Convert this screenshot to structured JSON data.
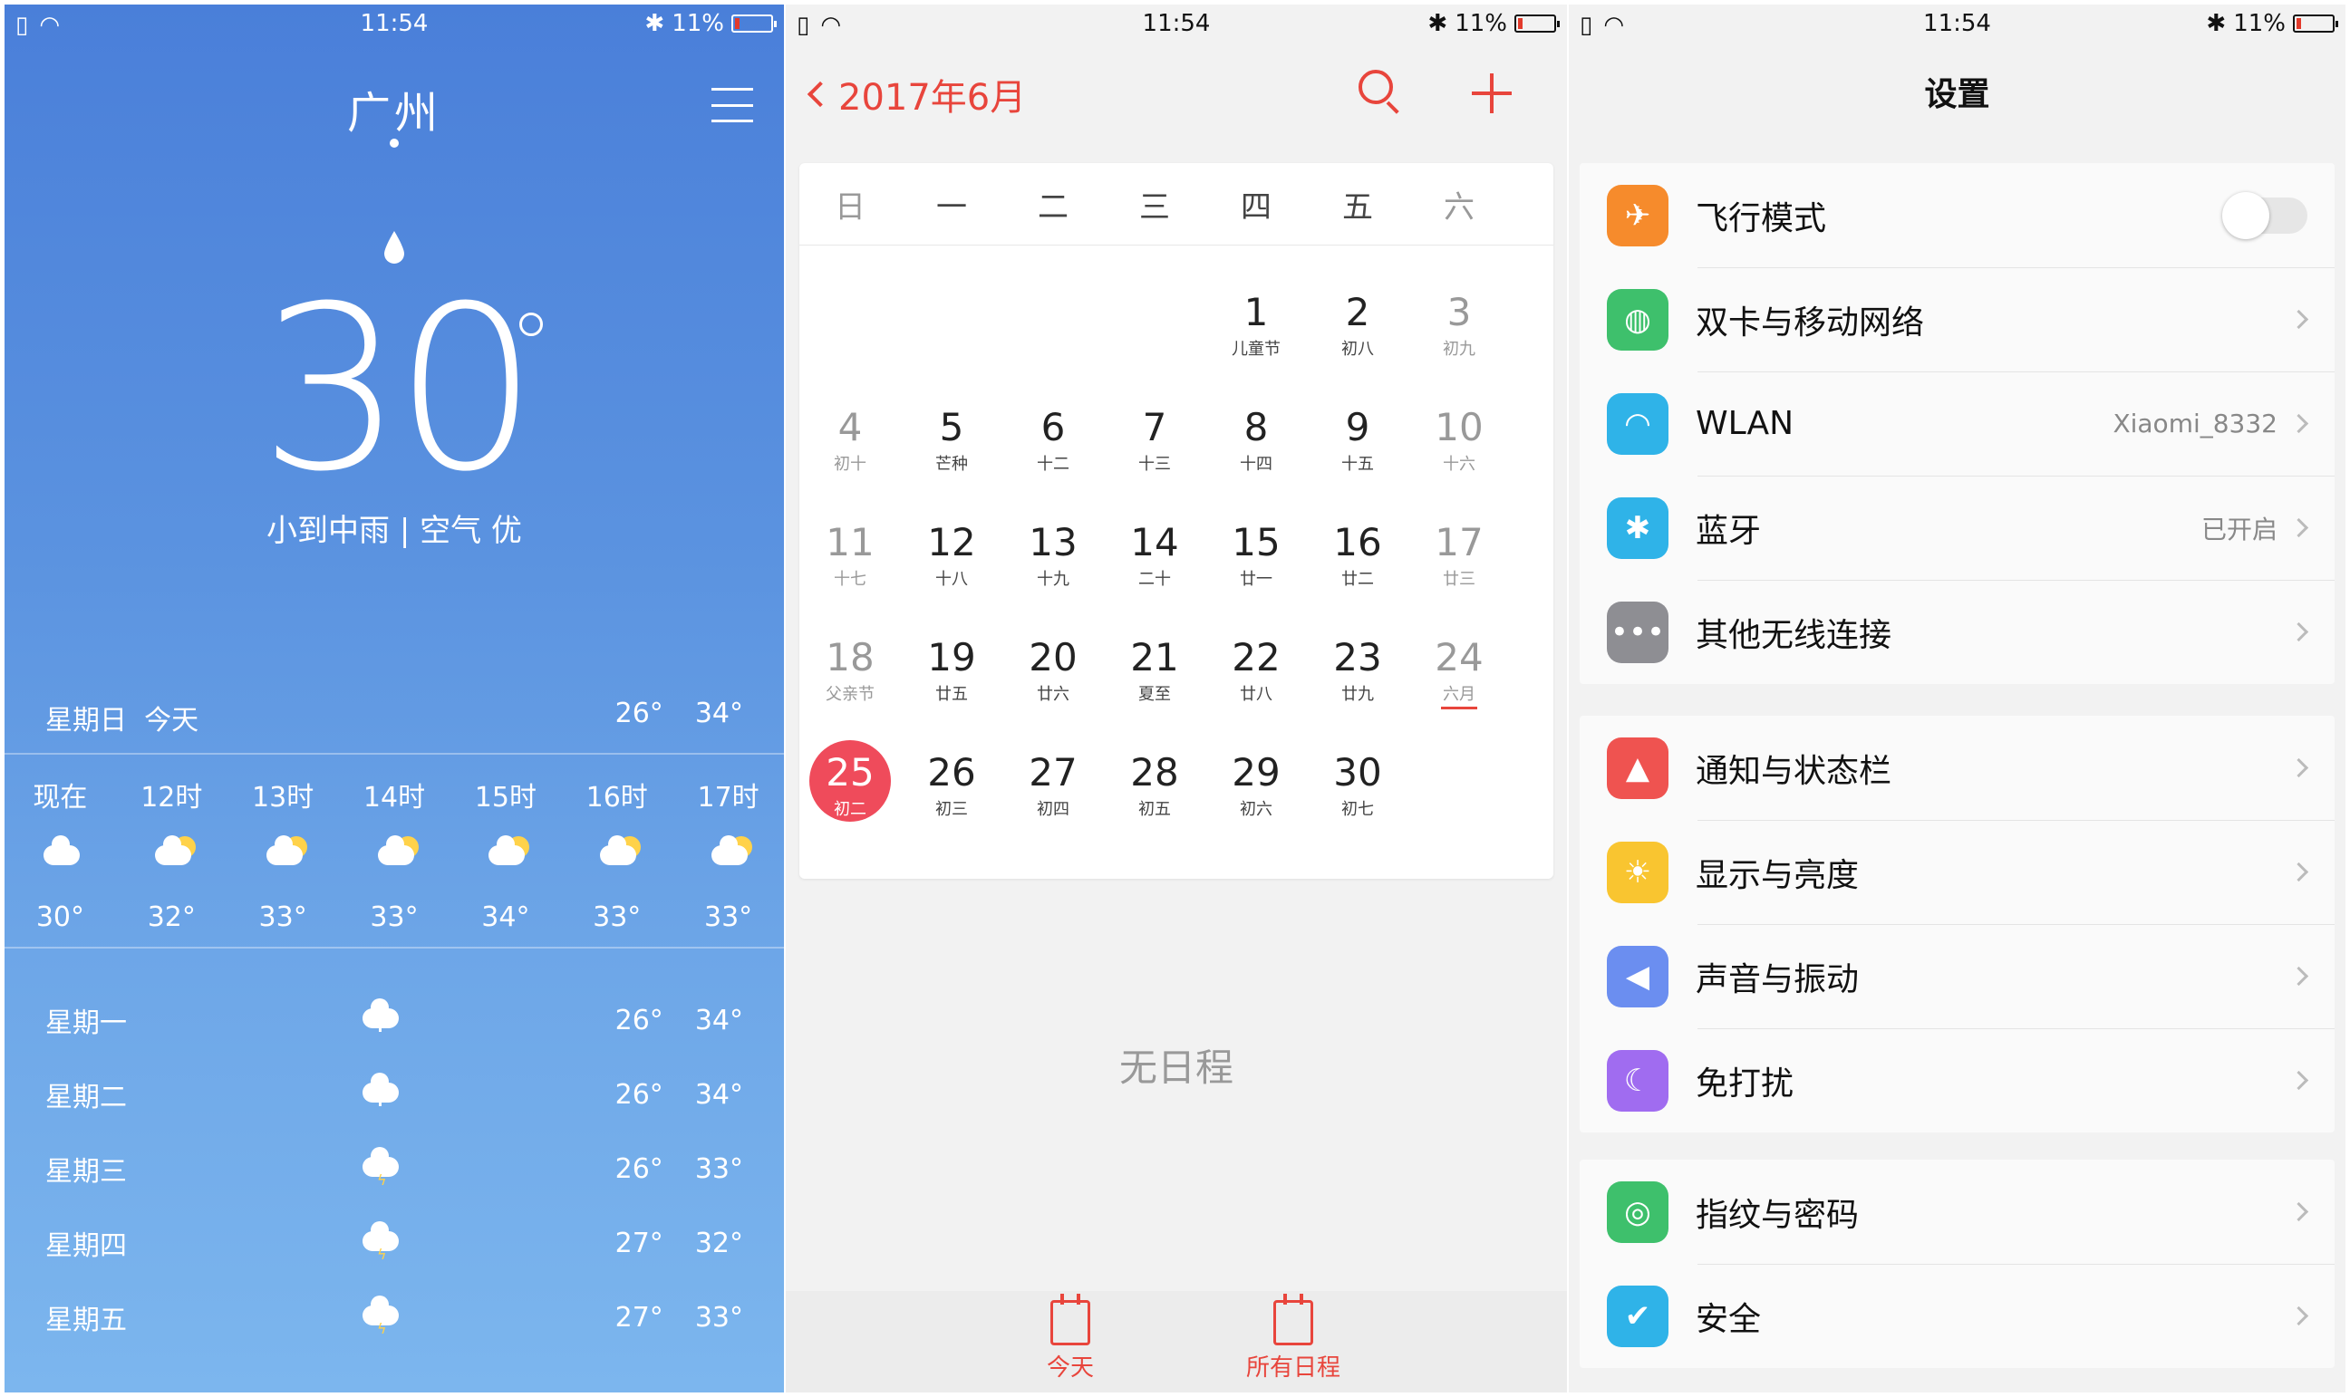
{
  "status": {
    "time": "11:54",
    "battery": "11%"
  },
  "weather": {
    "city": "广州",
    "temp": "30",
    "condition": "小到中雨 | 空气 优",
    "today": {
      "day": "星期日",
      "label": "今天",
      "low": "26°",
      "high": "34°"
    },
    "hourly": [
      {
        "time": "现在",
        "temp": "30°",
        "icon": "cloud-icon"
      },
      {
        "time": "12时",
        "temp": "32°",
        "icon": "partly-cloudy-icon"
      },
      {
        "time": "13时",
        "temp": "33°",
        "icon": "partly-cloudy-icon"
      },
      {
        "time": "14时",
        "temp": "33°",
        "icon": "partly-cloudy-icon"
      },
      {
        "time": "15时",
        "temp": "34°",
        "icon": "partly-cloudy-icon"
      },
      {
        "time": "16时",
        "temp": "33°",
        "icon": "partly-cloudy-icon"
      },
      {
        "time": "17时",
        "temp": "33°",
        "icon": "partly-cloudy-icon"
      }
    ],
    "daily": [
      {
        "day": "星期一",
        "low": "26°",
        "high": "34°",
        "icon": "rain-icon"
      },
      {
        "day": "星期二",
        "low": "26°",
        "high": "34°",
        "icon": "rain-icon"
      },
      {
        "day": "星期三",
        "low": "26°",
        "high": "33°",
        "icon": "thunderstorm-icon"
      },
      {
        "day": "星期四",
        "low": "27°",
        "high": "32°",
        "icon": "thunderstorm-icon"
      },
      {
        "day": "星期五",
        "low": "27°",
        "high": "33°",
        "icon": "thunderstorm-icon"
      }
    ]
  },
  "calendar": {
    "title": "2017年6月",
    "weekdays": [
      "日",
      "一",
      "二",
      "三",
      "四",
      "五",
      "六"
    ],
    "weeks": [
      [
        null,
        null,
        null,
        null,
        {
          "d": "1",
          "l": "儿童节"
        },
        {
          "d": "2",
          "l": "初八"
        },
        {
          "d": "3",
          "l": "初九"
        }
      ],
      [
        {
          "d": "4",
          "l": "初十"
        },
        {
          "d": "5",
          "l": "芒种"
        },
        {
          "d": "6",
          "l": "十二"
        },
        {
          "d": "7",
          "l": "十三"
        },
        {
          "d": "8",
          "l": "十四"
        },
        {
          "d": "9",
          "l": "十五"
        },
        {
          "d": "10",
          "l": "十六"
        }
      ],
      [
        {
          "d": "11",
          "l": "十七"
        },
        {
          "d": "12",
          "l": "十八"
        },
        {
          "d": "13",
          "l": "十九"
        },
        {
          "d": "14",
          "l": "二十"
        },
        {
          "d": "15",
          "l": "廿一"
        },
        {
          "d": "16",
          "l": "廿二"
        },
        {
          "d": "17",
          "l": "廿三"
        }
      ],
      [
        {
          "d": "18",
          "l": "父亲节"
        },
        {
          "d": "19",
          "l": "廿五"
        },
        {
          "d": "20",
          "l": "廿六"
        },
        {
          "d": "21",
          "l": "夏至"
        },
        {
          "d": "22",
          "l": "廿八"
        },
        {
          "d": "23",
          "l": "廿九"
        },
        {
          "d": "24",
          "l": "六月"
        }
      ],
      [
        {
          "d": "25",
          "l": "初二"
        },
        {
          "d": "26",
          "l": "初三"
        },
        {
          "d": "27",
          "l": "初四"
        },
        {
          "d": "28",
          "l": "初五"
        },
        {
          "d": "29",
          "l": "初六"
        },
        {
          "d": "30",
          "l": "初七"
        },
        null
      ]
    ],
    "selected": "25",
    "underlined": "24",
    "no_events": "无日程",
    "tab_today": "今天",
    "tab_all": "所有日程",
    "accent": "#e8453c"
  },
  "settings": {
    "title": "设置",
    "groups": [
      [
        {
          "label": "飞行模式",
          "icon": "airplane-icon",
          "color": "#f68b2c",
          "toggle": true,
          "value": ""
        },
        {
          "label": "双卡与移动网络",
          "icon": "globe-icon",
          "color": "#3ec06c",
          "value": ""
        },
        {
          "label": "WLAN",
          "icon": "wifi-icon",
          "color": "#2fb3e8",
          "value": "Xiaomi_8332"
        },
        {
          "label": "蓝牙",
          "icon": "bluetooth-icon",
          "color": "#2fb3e8",
          "value": "已开启"
        },
        {
          "label": "其他无线连接",
          "icon": "more-dots-icon",
          "color": "#8e8e93",
          "value": ""
        }
      ],
      [
        {
          "label": "通知与状态栏",
          "icon": "notification-icon",
          "color": "#ef5350",
          "value": ""
        },
        {
          "label": "显示与亮度",
          "icon": "brightness-icon",
          "color": "#f9c530",
          "value": ""
        },
        {
          "label": "声音与振动",
          "icon": "speaker-icon",
          "color": "#6b8ef0",
          "value": ""
        },
        {
          "label": "免打扰",
          "icon": "moon-icon",
          "color": "#a06cf0",
          "value": ""
        }
      ],
      [
        {
          "label": "指纹与密码",
          "icon": "fingerprint-icon",
          "color": "#3ec06c",
          "value": ""
        },
        {
          "label": "安全",
          "icon": "shield-icon",
          "color": "#2fb3e8",
          "value": ""
        }
      ]
    ]
  }
}
